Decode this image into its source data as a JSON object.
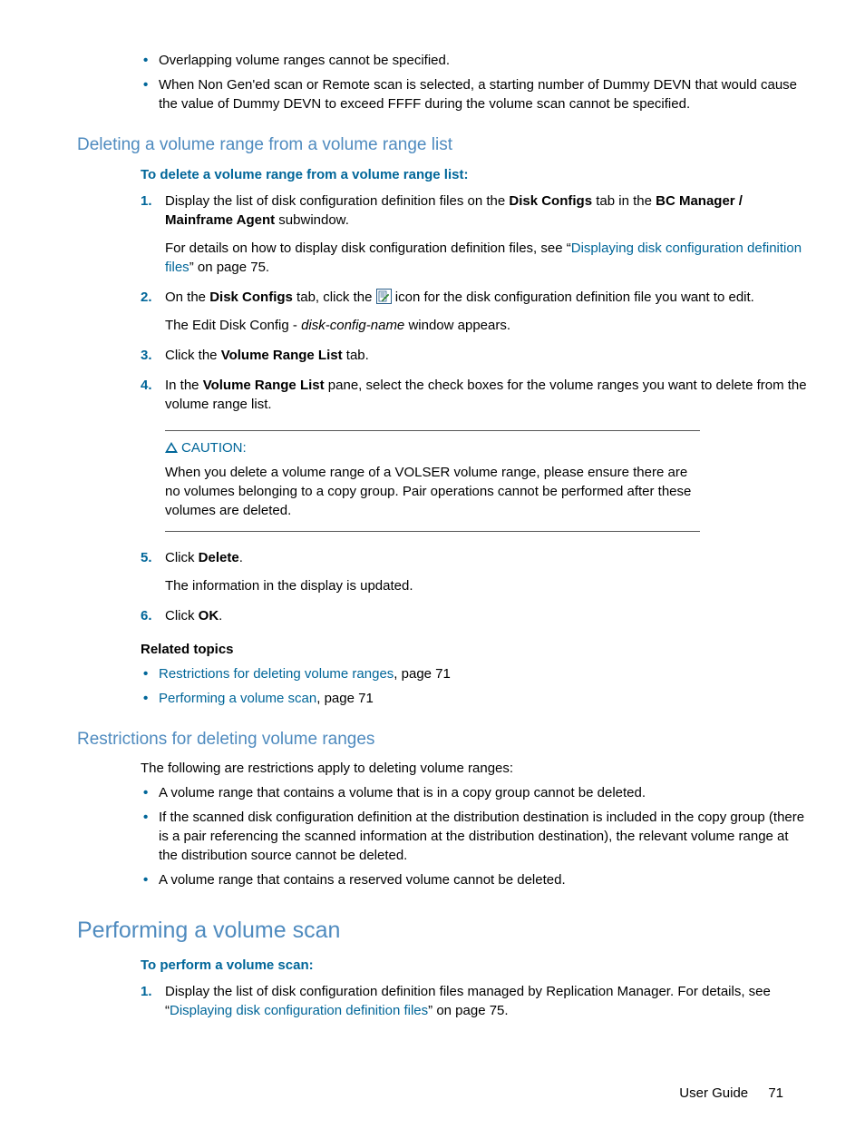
{
  "intro_bullets": [
    "Overlapping volume ranges cannot be specified.",
    "When Non Gen'ed scan or Remote scan is selected, a starting number of Dummy DEVN that would cause the value of Dummy DEVN to exceed FFFF during the volume scan cannot be specified."
  ],
  "section_delete": {
    "heading": "Deleting a volume range from a volume range list",
    "lead": "To delete a volume range from a volume range list:",
    "step1_a": "Display the list of disk configuration definition files on the ",
    "step1_b": "Disk Configs",
    "step1_c": " tab in the ",
    "step1_d": "BC Manager / Mainframe Agent",
    "step1_e": " subwindow.",
    "step1_sub_a": "For details on how to display disk configuration definition files, see “",
    "step1_sub_link": "Displaying disk configuration definition files",
    "step1_sub_b": "” on page 75.",
    "step2_a": "On the ",
    "step2_b": "Disk Configs",
    "step2_c": " tab, click the ",
    "step2_d": " icon for the disk configuration definition file you want to edit.",
    "step2_sub_a": "The Edit Disk Config - ",
    "step2_sub_i": "disk-config-name",
    "step2_sub_b": " window appears.",
    "step3_a": "Click the ",
    "step3_b": "Volume Range List",
    "step3_c": " tab.",
    "step4_a": "In the ",
    "step4_b": "Volume Range List",
    "step4_c": " pane, select the check boxes for the volume ranges you want to delete from the volume range list.",
    "caution_label": "CAUTION:",
    "caution_text": "When you delete a volume range of a VOLSER volume range, please ensure there are no volumes belonging to a copy group. Pair operations cannot be performed after these volumes are deleted.",
    "step5_a": "Click ",
    "step5_b": "Delete",
    "step5_c": ".",
    "step5_sub": "The information in the display is updated.",
    "step6_a": "Click ",
    "step6_b": "OK",
    "step6_c": ".",
    "related_heading": "Related topics",
    "related1_link": "Restrictions for deleting volume ranges",
    "related1_tail": ", page 71",
    "related2_link": "Performing a volume scan",
    "related2_tail": ", page 71"
  },
  "section_restrict": {
    "heading": "Restrictions for deleting volume ranges",
    "intro": "The following are restrictions apply to deleting volume ranges:",
    "bullets": [
      "A volume range that contains a volume that is in a copy group cannot be deleted.",
      "If the scanned disk configuration definition at the distribution destination is included in the copy group (there is a pair referencing the scanned information at the distribution destination), the relevant volume range at the distribution source cannot be deleted.",
      "A volume range that contains a reserved volume cannot be deleted."
    ]
  },
  "section_scan": {
    "heading": "Performing a volume scan",
    "lead": "To perform a volume scan:",
    "step1_a": "Display the list of disk configuration definition files managed by Replication Manager. For details, see “",
    "step1_link": "Displaying disk configuration definition files",
    "step1_b": "” on page 75."
  },
  "footer": {
    "title": "User Guide",
    "page": "71"
  }
}
